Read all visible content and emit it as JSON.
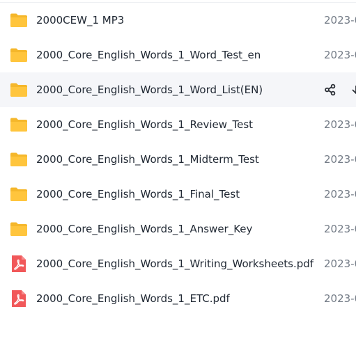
{
  "files": [
    {
      "name": "2000CEW_1 MP3",
      "type": "folder",
      "date": "2023-0"
    },
    {
      "name": "2000_Core_English_Words_1_Word_Test_en",
      "type": "folder",
      "date": "2023-0"
    },
    {
      "name": "2000_Core_English_Words_1_Word_List(EN)",
      "type": "folder",
      "date": "",
      "hovered": true,
      "actions": [
        "share-icon",
        "download-icon"
      ]
    },
    {
      "name": "2000_Core_English_Words_1_Review_Test",
      "type": "folder",
      "date": "2023-0"
    },
    {
      "name": "2000_Core_English_Words_1_Midterm_Test",
      "type": "folder",
      "date": "2023-0"
    },
    {
      "name": "2000_Core_English_Words_1_Final_Test",
      "type": "folder",
      "date": "2023-0"
    },
    {
      "name": "2000_Core_English_Words_1_Answer_Key",
      "type": "folder",
      "date": "2023-0"
    },
    {
      "name": "2000_Core_English_Words_1_Writing_Worksheets.pdf",
      "type": "pdf",
      "date": "2023-0"
    },
    {
      "name": "2000_Core_English_Words_1_ETC.pdf",
      "type": "pdf",
      "date": "2023-0"
    }
  ],
  "colors": {
    "folder": "#ffc53d",
    "folder_tab": "#f5b72b",
    "pdf": "#f1585a",
    "text": "#212934",
    "date": "#737b86",
    "hover_bg": "#f5f6f9",
    "icon_dark": "#2b2f36"
  }
}
